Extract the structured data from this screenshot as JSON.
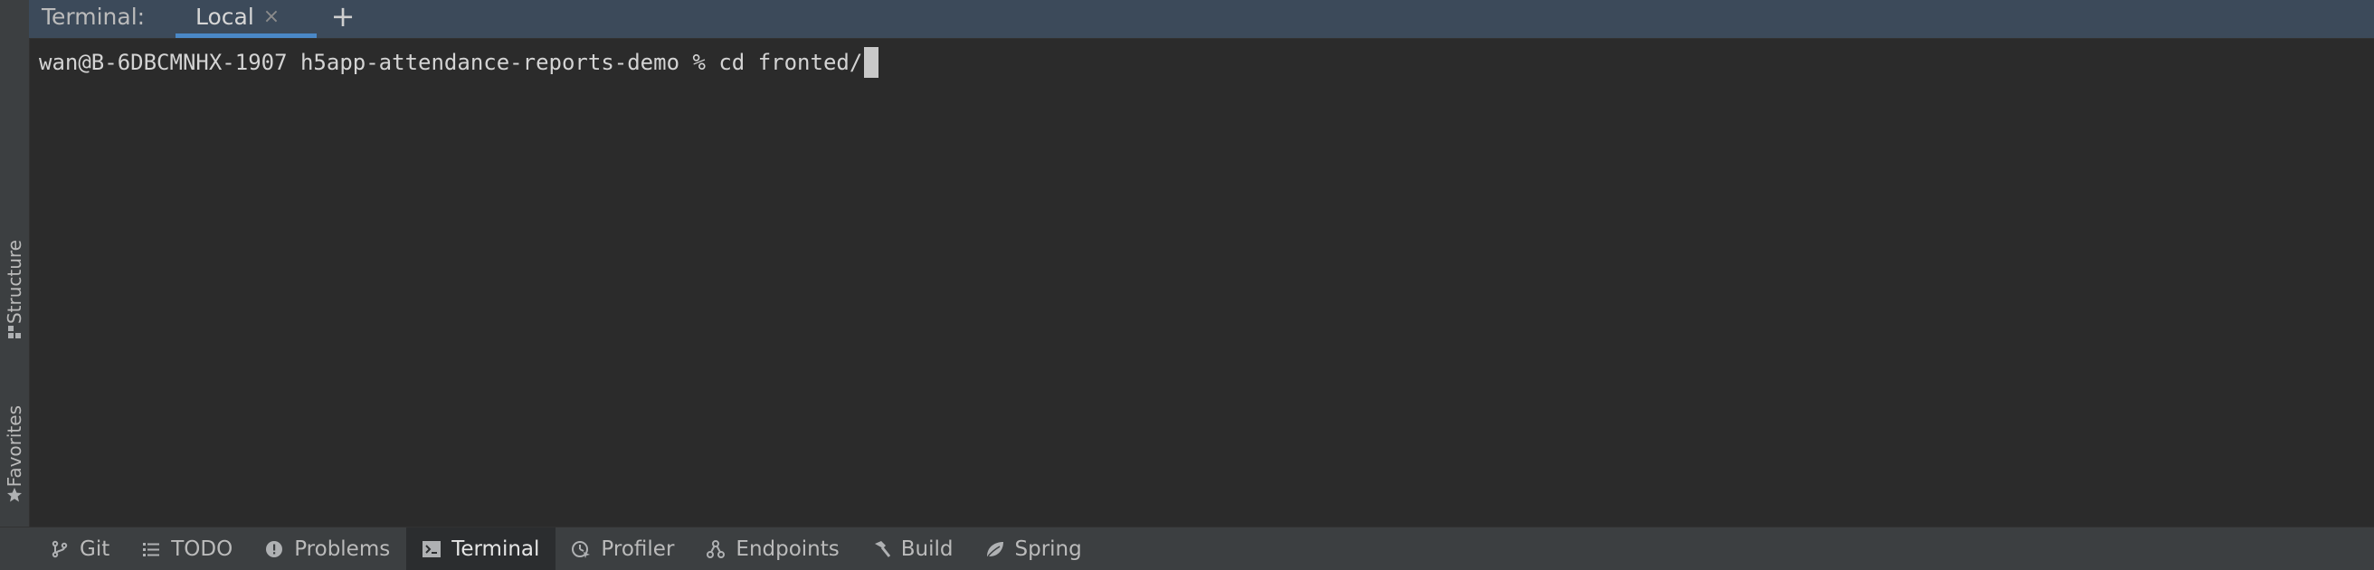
{
  "header": {
    "title": "Terminal:",
    "tab_label": "Local",
    "close_glyph": "×",
    "new_tab_glyph": "+"
  },
  "left_strip": {
    "structure_label": "Structure",
    "favorites_label": "Favorites"
  },
  "terminal": {
    "prompt": "wan@B-6DBCMNHX-1907 h5app-attendance-reports-demo % ",
    "command": "cd fronted/"
  },
  "bottom_bar": {
    "items": [
      {
        "label": "Git",
        "icon": "git-branch-icon"
      },
      {
        "label": "TODO",
        "icon": "list-icon"
      },
      {
        "label": "Problems",
        "icon": "alert-icon"
      },
      {
        "label": "Terminal",
        "icon": "terminal-icon",
        "active": true
      },
      {
        "label": "Profiler",
        "icon": "profiler-icon"
      },
      {
        "label": "Endpoints",
        "icon": "endpoints-icon"
      },
      {
        "label": "Build",
        "icon": "hammer-icon"
      },
      {
        "label": "Spring",
        "icon": "spring-leaf-icon"
      }
    ]
  },
  "colors": {
    "header_bg": "#3c4a5a",
    "tab_underline": "#4a88c7",
    "terminal_bg": "#2b2b2b",
    "toolbar_bg": "#3c3f41"
  }
}
